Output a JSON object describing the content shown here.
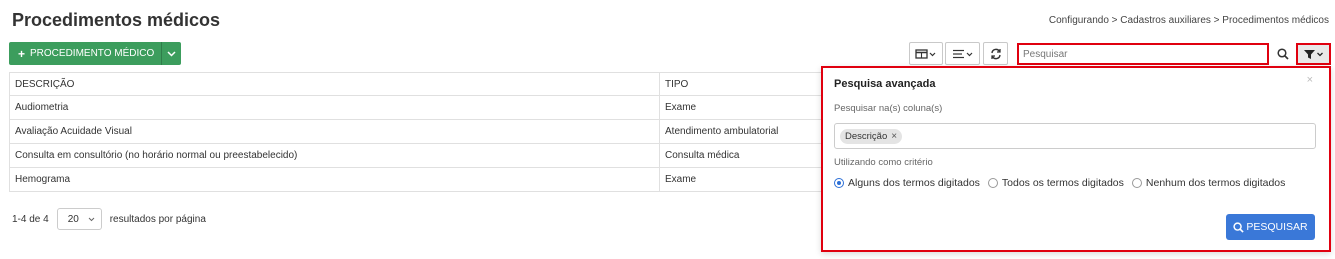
{
  "header": {
    "title": "Procedimentos médicos",
    "breadcrumb": "Configurando > Cadastros auxiliares > Procedimentos médicos"
  },
  "toolbar": {
    "add_label": "PROCEDIMENTO MÉDICO",
    "search_placeholder": "Pesquisar"
  },
  "table": {
    "columns": [
      "DESCRIÇÃO",
      "TIPO"
    ],
    "rows": [
      [
        "Audiometria",
        "Exame"
      ],
      [
        "Avaliação Acuidade Visual",
        "Atendimento ambulatorial"
      ],
      [
        "Consulta em consultório (no horário normal ou preestabelecido)",
        "Consulta médica"
      ],
      [
        "Hemograma",
        "Exame"
      ]
    ]
  },
  "pagination": {
    "range": "1-4 de 4",
    "per_page": "20",
    "per_page_label": "resultados por página"
  },
  "advanced_search": {
    "title": "Pesquisa avançada",
    "close": "×",
    "columns_label": "Pesquisar na(s) coluna(s)",
    "selected_column": "Descrição",
    "chip_remove": "×",
    "criteria_label": "Utilizando como critério",
    "options": [
      "Alguns dos termos digitados",
      "Todos os termos digitados",
      "Nenhum dos termos digitados"
    ],
    "selected_option_index": 0,
    "submit_label": "PESQUISAR"
  },
  "colors": {
    "primary_green": "#3c9d5d",
    "primary_blue": "#3a78d8",
    "highlight_red": "#e0000f"
  }
}
